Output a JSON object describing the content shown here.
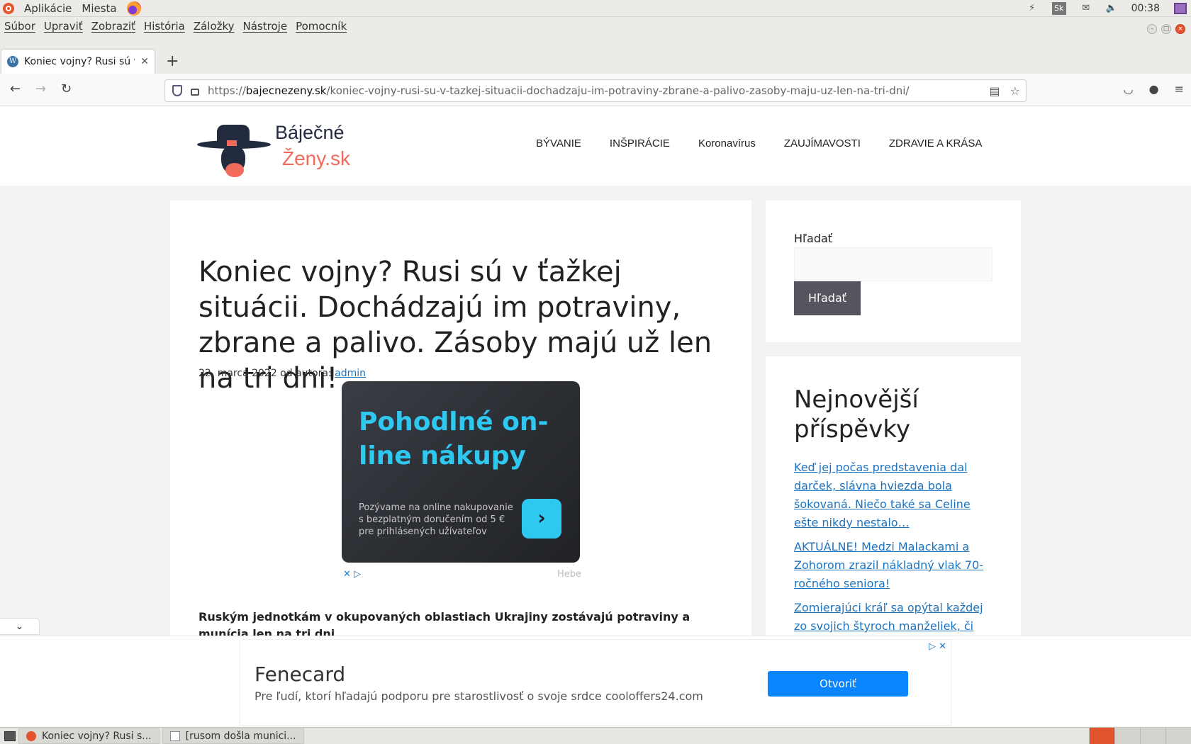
{
  "system_panel": {
    "apps_menu": "Aplikácie",
    "places_menu": "Miesta",
    "keyboard_layout": "Sk",
    "clock": "00:38"
  },
  "menubar": {
    "items": [
      "Súbor",
      "Upraviť",
      "Zobraziť",
      "História",
      "Záložky",
      "Nástroje",
      "Pomocník"
    ]
  },
  "tab": {
    "title": "Koniec vojny? Rusi sú v ťa",
    "new_tab_label": "+"
  },
  "url": {
    "scheme": "https://",
    "host": "bajecnezeny.sk",
    "path": "/koniec-vojny-rusi-su-v-tazkej-situacii-dochadzaju-im-potraviny-zbrane-a-palivo-zasoby-maju-uz-len-na-tri-dni/"
  },
  "site": {
    "logo_line1": "Báječné",
    "logo_line2": "Ženy.sk",
    "nav": [
      "BÝVANIE",
      "INŠPIRÁCIE",
      "Koronavírus",
      "ZAUJÍMAVOSTI",
      "ZDRAVIE A KRÁSA"
    ]
  },
  "post": {
    "title": "Koniec vojny? Rusi sú v ťažkej situácii. Dochádzajú im potraviny, zbrane a palivo. Zásoby majú už len na tri dni!",
    "date_prefix": "22. marca 2022 od autora: ",
    "author": "admin",
    "lead": "Ruským jednotkám v okupovaných oblastiach Ukrajiny zostávajú potraviny a munícia len na tri dni."
  },
  "inline_ad": {
    "headline": "Pohodlné on-line nákupy",
    "description": "Pozývame na online nakupovanie s bezplatným doručením od 5 € pre prihlásených užívateľov",
    "brand": "Hebe",
    "go_symbol": "›"
  },
  "sidebar": {
    "search_label": "Hľadať",
    "search_button": "Hľadať",
    "recent_heading": "Nejnovější příspěvky",
    "recent_posts": [
      "Keď jej počas predstavenia dal darček, slávna hviezda bola šokovaná. Niečo také sa Celine ešte nikdy nestalo…",
      "AKTUÁLNE! Medzi Malackami a Zohorom zrazil nákladný vlak 70-ročného seniora!",
      "Zomierajúci kráľ sa opýtal každej zo svojich štyroch manželiek, či mu"
    ]
  },
  "bottom_ad": {
    "name": "Fenecard",
    "description": "Pre ľudí, ktorí hľadajú podporu pre starostlivosť o svoje srdce cooloffers24.com",
    "button": "Otvoriť"
  },
  "taskbar": {
    "items": [
      "Koniec vojny? Rusi s...",
      "[rusom došla munici..."
    ]
  },
  "colors": {
    "accent_link": "#1e73be",
    "logo_coral": "#f16a5c",
    "ad_cyan": "#2ec8f0",
    "ad_button_blue": "#0a84ff"
  }
}
